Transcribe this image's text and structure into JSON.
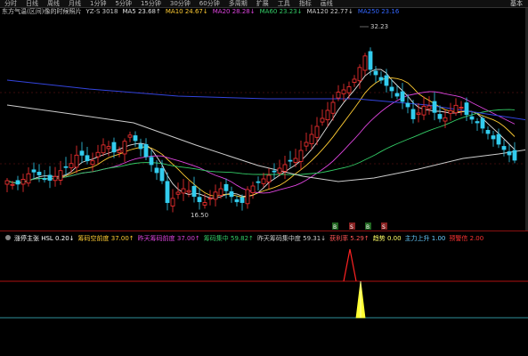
{
  "topbar": {
    "tabs": [
      "分时",
      "日线",
      "周线",
      "月线",
      "1分钟",
      "5分钟",
      "15分钟",
      "30分钟",
      "60分钟",
      "多周期",
      "扩展",
      "工具",
      "指标",
      "画线"
    ],
    "right_label": "基本"
  },
  "main": {
    "legend": [
      {
        "label": "东方气温(区间)像的时候照片",
        "color": "#cccccc"
      },
      {
        "label": "YZ-S 3018",
        "color": "#cccccc"
      },
      {
        "label": "MA5 23.68↑",
        "color": "#e0e0e0"
      },
      {
        "label": "MA10 24.67↓",
        "color": "#ffcc33"
      },
      {
        "label": "MA20 28.28↓",
        "color": "#dd44dd"
      },
      {
        "label": "MA60 23.23↓",
        "color": "#33cc66"
      },
      {
        "label": "MA120 22.77↓",
        "color": "#cccccc"
      },
      {
        "label": "MA250 23.16",
        "color": "#3366ff"
      }
    ],
    "high_label": "32.23",
    "low_label": "16.50",
    "signal_markers": [
      "B",
      "S",
      "B",
      "S"
    ]
  },
  "sub": {
    "legend": [
      {
        "label": "涨停主张 HSL 0.20↓",
        "color": "#ffffff"
      },
      {
        "label": "筹码空前度 37.00↑",
        "color": "#ffcc33"
      },
      {
        "label": "昨天筹码前度 37.00↑",
        "color": "#dd44dd"
      },
      {
        "label": "筹码集中 59.82↑",
        "color": "#33cc66"
      },
      {
        "label": "昨天筹码集中度 59.31↓",
        "color": "#cccccc"
      },
      {
        "label": "获利率 5.29↑",
        "color": "#ff5555"
      },
      {
        "label": "趋势 0.00",
        "color": "#ffff66"
      },
      {
        "label": "主力上升 1.00",
        "color": "#66ccff"
      },
      {
        "label": "预警信 2.00",
        "color": "#ff3333"
      }
    ]
  },
  "colors": {
    "up": "#ff3333",
    "down": "#33ccee",
    "ma5": "#e0e0e0",
    "ma10": "#ffcc33",
    "ma20": "#dd44dd",
    "ma60": "#33cc66",
    "ma120": "#cccccc",
    "ma250": "#3344dd"
  }
}
